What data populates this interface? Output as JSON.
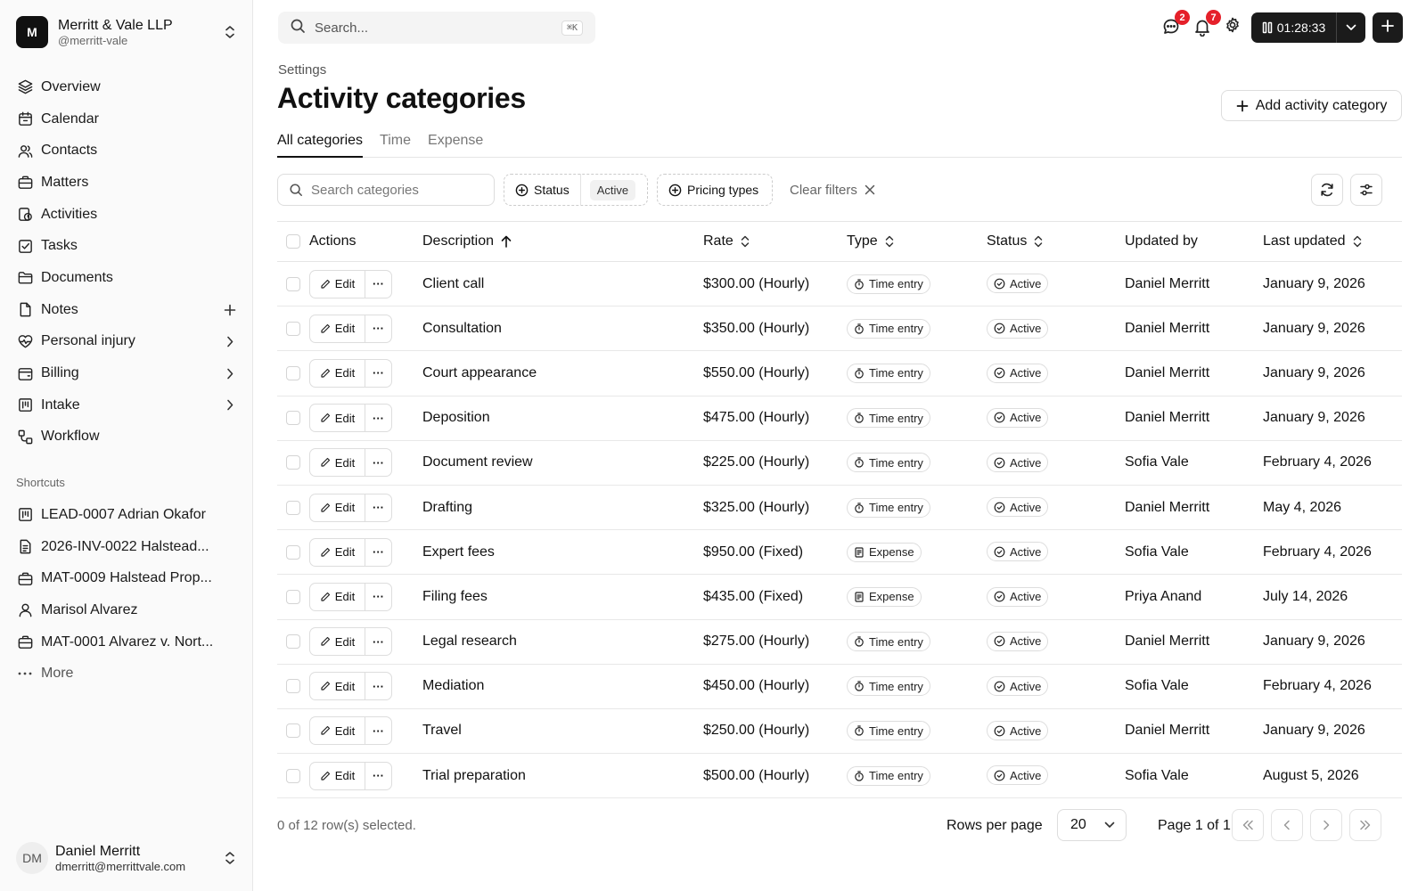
{
  "org": {
    "initial": "M",
    "name": "Merritt & Vale LLP",
    "handle": "@merritt-vale"
  },
  "nav": [
    {
      "label": "Overview",
      "icon": "layers-icon"
    },
    {
      "label": "Calendar",
      "icon": "calendar-icon"
    },
    {
      "label": "Contacts",
      "icon": "users-icon"
    },
    {
      "label": "Matters",
      "icon": "briefcase-icon"
    },
    {
      "label": "Activities",
      "icon": "activity-icon"
    },
    {
      "label": "Tasks",
      "icon": "checkbox-icon"
    },
    {
      "label": "Documents",
      "icon": "folder-icon"
    },
    {
      "label": "Notes",
      "icon": "file-icon",
      "trail": "plus"
    },
    {
      "label": "Personal injury",
      "icon": "heart-pulse-icon",
      "trail": "chevron"
    },
    {
      "label": "Billing",
      "icon": "wallet-icon",
      "trail": "chevron"
    },
    {
      "label": "Intake",
      "icon": "kanban-icon",
      "trail": "chevron"
    },
    {
      "label": "Workflow",
      "icon": "workflow-icon"
    }
  ],
  "shortcuts_title": "Shortcuts",
  "shortcuts": [
    {
      "label": "LEAD-0007 Adrian Okafor",
      "icon": "kanban-icon"
    },
    {
      "label": "2026-INV-0022 Halstead...",
      "icon": "invoice-icon"
    },
    {
      "label": "MAT-0009 Halstead Prop...",
      "icon": "briefcase-icon"
    },
    {
      "label": "Marisol Alvarez",
      "icon": "user-icon"
    },
    {
      "label": "MAT-0001 Alvarez v. Nort...",
      "icon": "briefcase-icon"
    }
  ],
  "more_label": "More",
  "user": {
    "initials": "DM",
    "name": "Daniel Merritt",
    "email": "dmerritt@merrittvale.com"
  },
  "topbar": {
    "search_placeholder": "Search...",
    "shortcut": "⌘K",
    "messages_badge": "2",
    "notifications_badge": "7",
    "timer": "01:28:33"
  },
  "breadcrumb": "Settings",
  "title": "Activity categories",
  "add_button": "Add activity category",
  "tabs": [
    "All categories",
    "Time",
    "Expense"
  ],
  "filters": {
    "search_placeholder": "Search categories",
    "status_label": "Status",
    "status_value": "Active",
    "pricing_label": "Pricing types",
    "clear_label": "Clear filters"
  },
  "columns": {
    "actions": "Actions",
    "description": "Description",
    "rate": "Rate",
    "type": "Type",
    "status": "Status",
    "updated_by": "Updated by",
    "last_updated": "Last updated"
  },
  "edit_label": "Edit",
  "more_dots": "···",
  "rows": [
    {
      "description": "Client call",
      "rate": "$300.00 (Hourly)",
      "type": "Time entry",
      "status": "Active",
      "updated_by": "Daniel Merritt",
      "last_updated": "January 9, 2026"
    },
    {
      "description": "Consultation",
      "rate": "$350.00 (Hourly)",
      "type": "Time entry",
      "status": "Active",
      "updated_by": "Daniel Merritt",
      "last_updated": "January 9, 2026"
    },
    {
      "description": "Court appearance",
      "rate": "$550.00 (Hourly)",
      "type": "Time entry",
      "status": "Active",
      "updated_by": "Daniel Merritt",
      "last_updated": "January 9, 2026"
    },
    {
      "description": "Deposition",
      "rate": "$475.00 (Hourly)",
      "type": "Time entry",
      "status": "Active",
      "updated_by": "Daniel Merritt",
      "last_updated": "January 9, 2026"
    },
    {
      "description": "Document review",
      "rate": "$225.00 (Hourly)",
      "type": "Time entry",
      "status": "Active",
      "updated_by": "Sofia Vale",
      "last_updated": "February 4, 2026"
    },
    {
      "description": "Drafting",
      "rate": "$325.00 (Hourly)",
      "type": "Time entry",
      "status": "Active",
      "updated_by": "Daniel Merritt",
      "last_updated": "May 4, 2026"
    },
    {
      "description": "Expert fees",
      "rate": "$950.00 (Fixed)",
      "type": "Expense",
      "status": "Active",
      "updated_by": "Sofia Vale",
      "last_updated": "February 4, 2026"
    },
    {
      "description": "Filing fees",
      "rate": "$435.00 (Fixed)",
      "type": "Expense",
      "status": "Active",
      "updated_by": "Priya Anand",
      "last_updated": "July 14, 2026"
    },
    {
      "description": "Legal research",
      "rate": "$275.00 (Hourly)",
      "type": "Time entry",
      "status": "Active",
      "updated_by": "Daniel Merritt",
      "last_updated": "January 9, 2026"
    },
    {
      "description": "Mediation",
      "rate": "$450.00 (Hourly)",
      "type": "Time entry",
      "status": "Active",
      "updated_by": "Sofia Vale",
      "last_updated": "February 4, 2026"
    },
    {
      "description": "Travel",
      "rate": "$250.00 (Hourly)",
      "type": "Time entry",
      "status": "Active",
      "updated_by": "Daniel Merritt",
      "last_updated": "January 9, 2026"
    },
    {
      "description": "Trial preparation",
      "rate": "$500.00 (Hourly)",
      "type": "Time entry",
      "status": "Active",
      "updated_by": "Sofia Vale",
      "last_updated": "August 5, 2026"
    }
  ],
  "footer": {
    "selected": "0 of 12 row(s) selected.",
    "rows_per_page_label": "Rows per page",
    "rows_per_page": "20",
    "page_of": "Page 1 of 1"
  },
  "colors": {
    "badge": "#e5202a",
    "dark": "#1b1b1b"
  }
}
